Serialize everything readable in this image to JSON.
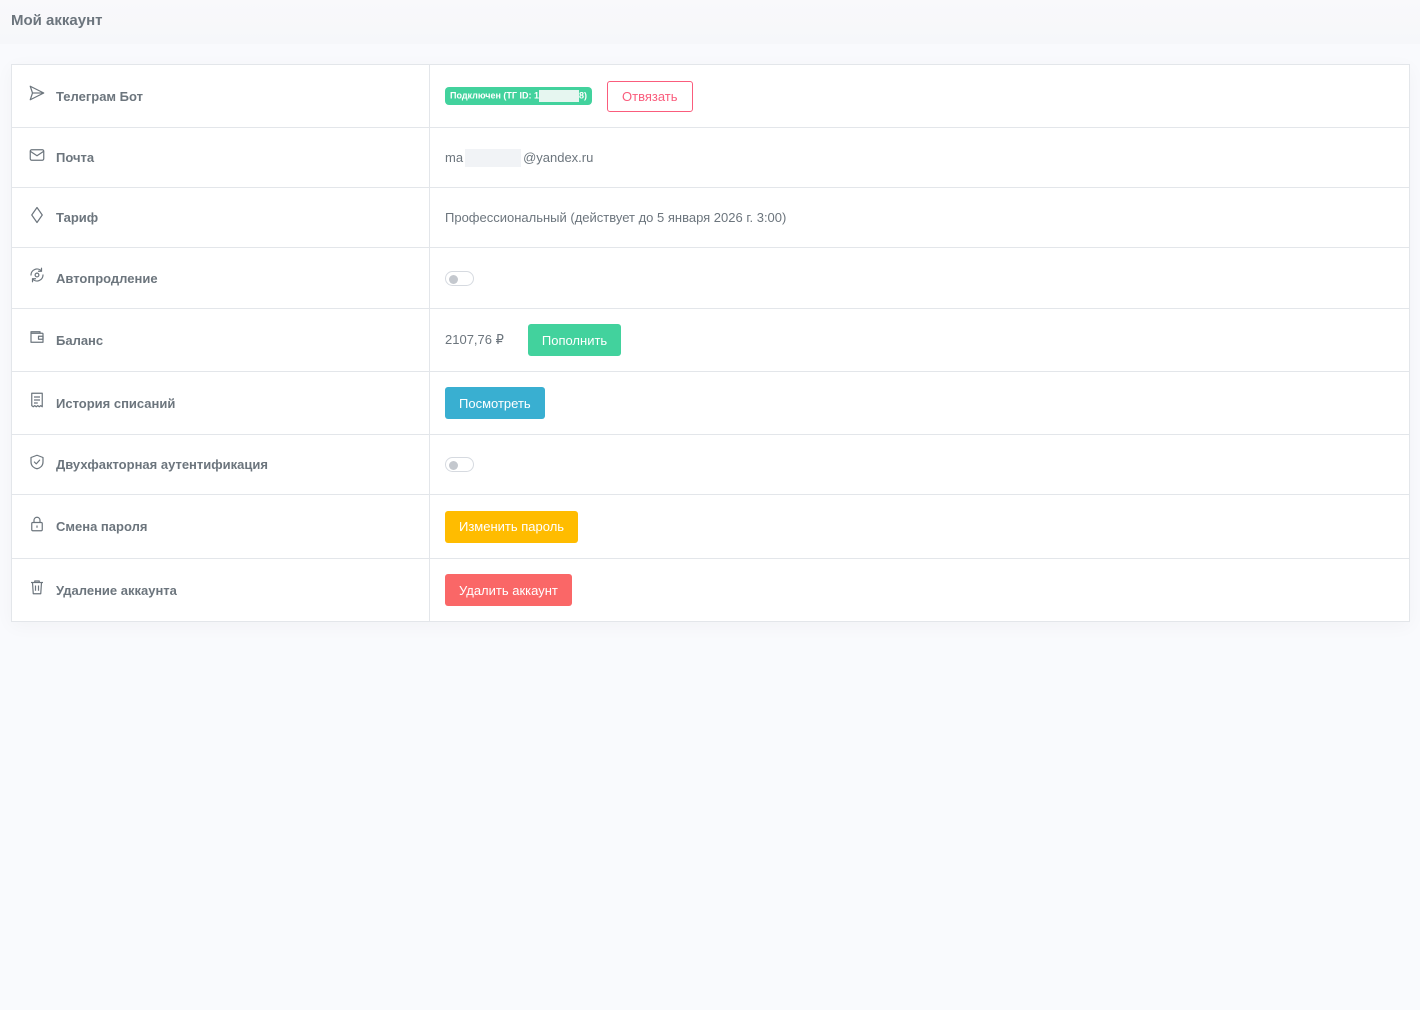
{
  "page": {
    "title": "Мой аккаунт"
  },
  "rows": {
    "telegram": {
      "icon": "send-icon",
      "label": "Телеграм Бот",
      "badge_prefix": "Подключен (ТГ ID: 1",
      "badge_suffix": "8)",
      "unlink_label": "Отвязать"
    },
    "email": {
      "icon": "mail-icon",
      "label": "Почта",
      "value_prefix": "ma",
      "value_suffix": "@yandex.ru"
    },
    "tariff": {
      "icon": "diamond-icon",
      "label": "Тариф",
      "value": "Профессиональный (действует до 5 января 2026 г. 3:00)"
    },
    "autorenew": {
      "icon": "refresh-icon",
      "label": "Автопродление",
      "enabled": false
    },
    "balance": {
      "icon": "wallet-icon",
      "label": "Баланс",
      "value": "2107,76 ₽",
      "topup_label": "Пополнить"
    },
    "history": {
      "icon": "receipt-icon",
      "label": "История списаний",
      "view_label": "Посмотреть"
    },
    "twofa": {
      "icon": "shield-check-icon",
      "label": "Двухфакторная аутентификация",
      "enabled": false
    },
    "password": {
      "icon": "lock-icon",
      "label": "Смена пароля",
      "change_label": "Изменить пароль"
    },
    "delete": {
      "icon": "trash-icon",
      "label": "Удаление аккаунта",
      "delete_label": "Удалить аккаунт"
    }
  },
  "colors": {
    "success": "#42d29d",
    "info": "#39afd1",
    "warning": "#ffbc00",
    "danger": "#fa6767",
    "text": "#6c757d"
  }
}
